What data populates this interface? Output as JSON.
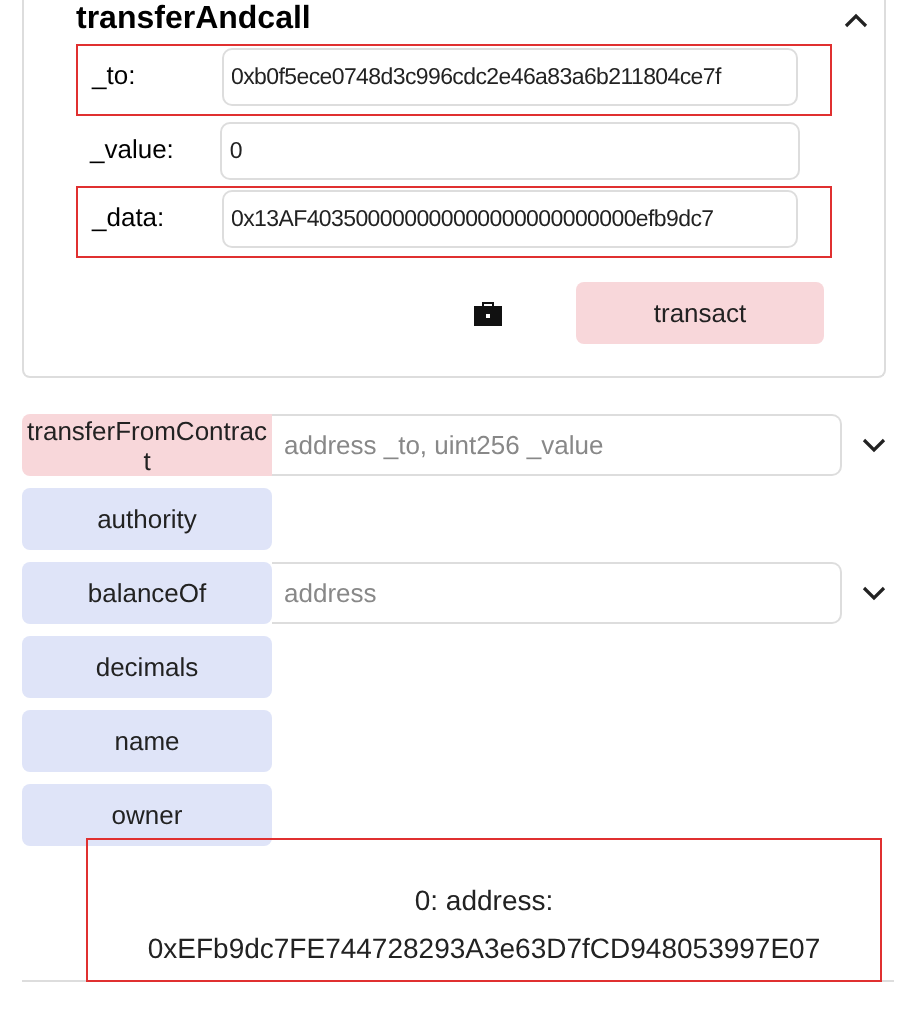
{
  "panel": {
    "title": "transferAndcall",
    "expanded": true,
    "params": [
      {
        "label": "_to:",
        "value": "0xb0f5ece0748d3c996cdc2e46a83a6b211804ce7f",
        "highlighted": true
      },
      {
        "label": "_value:",
        "value": "0",
        "highlighted": false
      },
      {
        "label": "_data:",
        "value": "0x13AF403500000000000000000000000efb9dc7",
        "highlighted": true
      }
    ],
    "button": "transact"
  },
  "functions": [
    {
      "name": "transferFromContract",
      "kind": "transact",
      "placeholder": "address _to, uint256 _value"
    },
    {
      "name": "authority",
      "kind": "call"
    },
    {
      "name": "balanceOf",
      "kind": "call",
      "placeholder": "address"
    },
    {
      "name": "decimals",
      "kind": "call"
    },
    {
      "name": "name",
      "kind": "call"
    },
    {
      "name": "owner",
      "kind": "call"
    }
  ],
  "result": {
    "lines": [
      "0: address:",
      "0xEFb9dc7FE744728293A3e63D7fCD948053997E07"
    ],
    "highlighted": true
  }
}
